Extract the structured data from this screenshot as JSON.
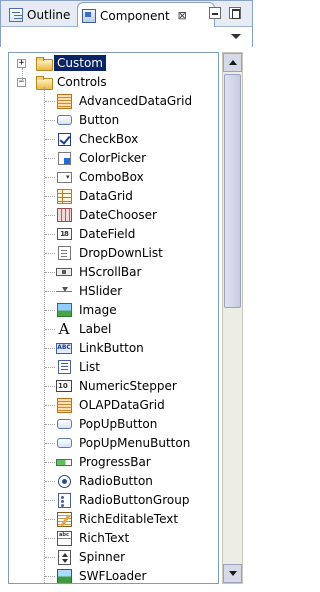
{
  "tabs": {
    "outline_label": "Outline",
    "component_label": "Component",
    "close_symbol": "⊠"
  },
  "tree": {
    "categories": [
      {
        "label": "Custom",
        "expander": "+",
        "selected": true
      },
      {
        "label": "Controls",
        "expander": "−",
        "selected": false
      }
    ],
    "controls": [
      {
        "label": "AdvancedDataGrid",
        "icon": "advanced-data-grid-icon"
      },
      {
        "label": "Button",
        "icon": "button-icon"
      },
      {
        "label": "CheckBox",
        "icon": "checkbox-icon"
      },
      {
        "label": "ColorPicker",
        "icon": "color-picker-icon"
      },
      {
        "label": "ComboBox",
        "icon": "combobox-icon"
      },
      {
        "label": "DataGrid",
        "icon": "data-grid-icon"
      },
      {
        "label": "DateChooser",
        "icon": "date-chooser-icon"
      },
      {
        "label": "DateField",
        "icon": "date-field-icon"
      },
      {
        "label": "DropDownList",
        "icon": "dropdown-list-icon"
      },
      {
        "label": "HScrollBar",
        "icon": "hscrollbar-icon"
      },
      {
        "label": "HSlider",
        "icon": "hslider-icon"
      },
      {
        "label": "Image",
        "icon": "image-icon"
      },
      {
        "label": "Label",
        "icon": "label-icon"
      },
      {
        "label": "LinkButton",
        "icon": "link-button-icon"
      },
      {
        "label": "List",
        "icon": "list-icon"
      },
      {
        "label": "NumericStepper",
        "icon": "numeric-stepper-icon"
      },
      {
        "label": "OLAPDataGrid",
        "icon": "olap-data-grid-icon"
      },
      {
        "label": "PopUpButton",
        "icon": "popup-button-icon"
      },
      {
        "label": "PopUpMenuButton",
        "icon": "popup-menu-button-icon"
      },
      {
        "label": "ProgressBar",
        "icon": "progress-bar-icon"
      },
      {
        "label": "RadioButton",
        "icon": "radio-button-icon"
      },
      {
        "label": "RadioButtonGroup",
        "icon": "radio-button-group-icon"
      },
      {
        "label": "RichEditableText",
        "icon": "rich-editable-text-icon"
      },
      {
        "label": "RichText",
        "icon": "rich-text-icon"
      },
      {
        "label": "Spinner",
        "icon": "spinner-icon"
      },
      {
        "label": "SWFLoader",
        "icon": "swf-loader-icon"
      }
    ],
    "icon_text": {
      "combobox": "▾",
      "datefield": "18",
      "link": "ABC",
      "numeric": "10",
      "richtext": "abc",
      "label": "A"
    }
  },
  "colors": {
    "selection_bg": "#0a246a",
    "selection_fg": "#ffffff",
    "tab_border": "#8aa2c8"
  }
}
